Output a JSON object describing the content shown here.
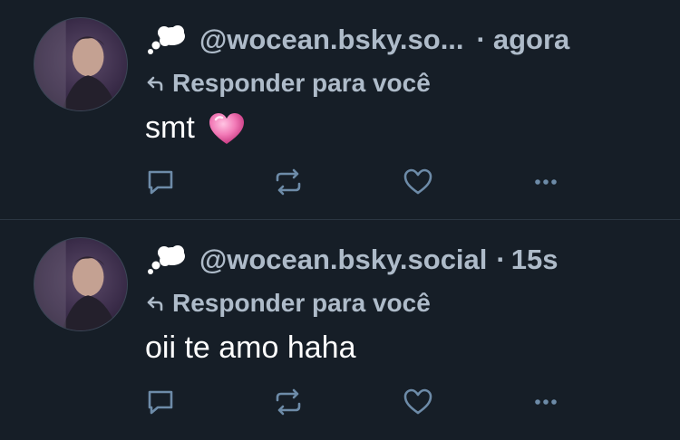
{
  "posts": [
    {
      "handle": "@wocean.bsky.so...",
      "separator": "·",
      "time": "agora",
      "reply_label": "Responder para você",
      "text": "smt",
      "has_heart_emoji": true
    },
    {
      "handle": "@wocean.bsky.social",
      "separator": "·",
      "time": "15s",
      "reply_label": "Responder para você",
      "text": "oii te amo haha",
      "has_heart_emoji": false
    }
  ],
  "icons": {
    "profile_emoji": "thought-bubble-icon",
    "reply": "reply-arrow-icon",
    "heart_emoji": "pink-heart-icon",
    "comment": "comment-icon",
    "repost": "repost-icon",
    "like": "heart-outline-icon",
    "more": "more-dots-icon"
  },
  "colors": {
    "background": "#161e27",
    "text_primary": "#ffffff",
    "text_secondary": "#aebbc9",
    "divider": "#2b3642",
    "heart_emoji": "#f27bb7"
  }
}
